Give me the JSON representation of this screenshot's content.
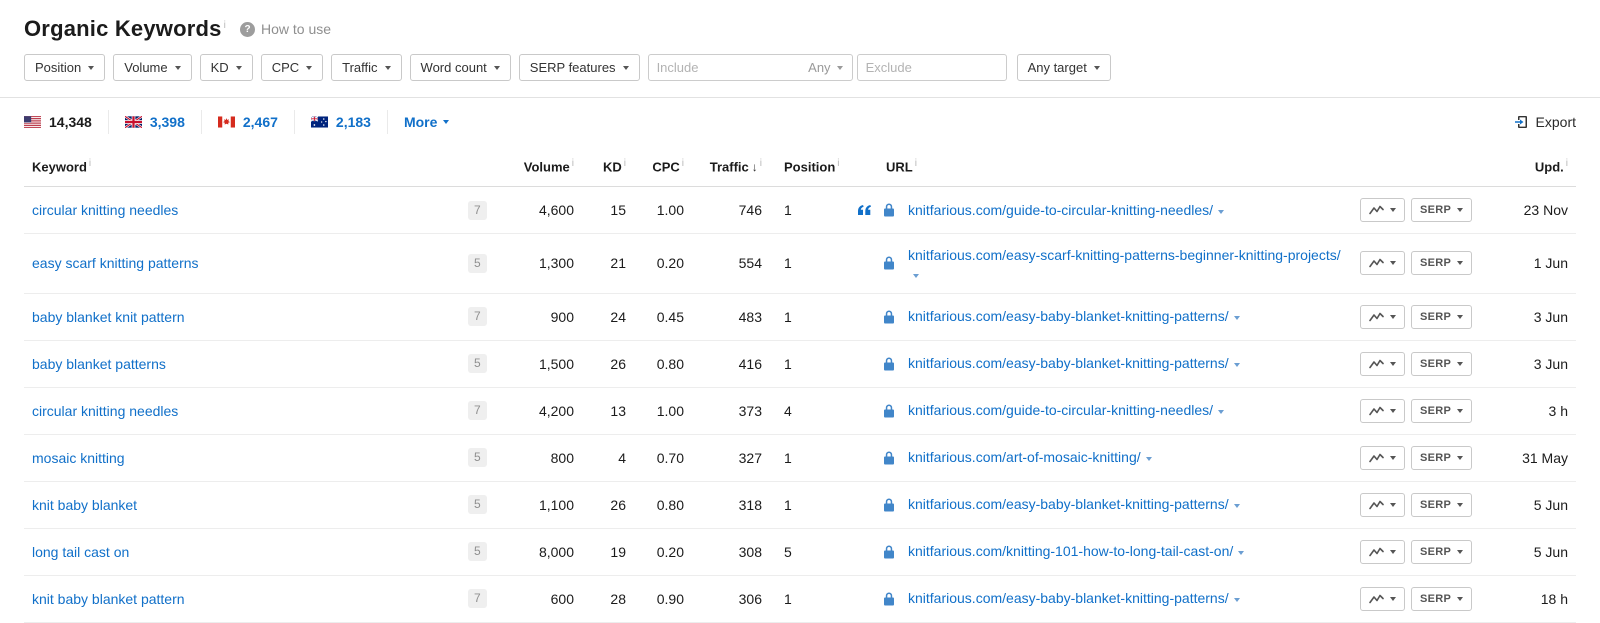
{
  "colors": {
    "link": "#1170c9",
    "text": "#1b1b1b",
    "muted": "#8f8f8f",
    "border": "#c9c9c9",
    "lock": "#4186c9"
  },
  "misc": {
    "info_mark": "i"
  },
  "header": {
    "title": "Organic Keywords",
    "help_mark": "?",
    "how_to_use": "How to use"
  },
  "filters": {
    "dropdowns": [
      "Position",
      "Volume",
      "KD",
      "CPC",
      "Traffic",
      "Word count",
      "SERP features"
    ],
    "include": {
      "placeholder": "Include",
      "mode": "Any"
    },
    "exclude": {
      "placeholder": "Exclude"
    },
    "target_label": "Any target"
  },
  "tabs": {
    "items": [
      {
        "country": "United States",
        "count": "14,348",
        "active": true
      },
      {
        "country": "United Kingdom",
        "count": "3,398",
        "active": false
      },
      {
        "country": "Canada",
        "count": "2,467",
        "active": false
      },
      {
        "country": "Australia",
        "count": "2,183",
        "active": false
      }
    ],
    "more_label": "More",
    "export_label": "Export"
  },
  "table": {
    "headers": {
      "keyword": "Keyword",
      "volume": "Volume",
      "kd": "KD",
      "cpc": "CPC",
      "traffic": "Traffic",
      "position": "Position",
      "url": "URL",
      "upd": "Upd."
    },
    "sort_indicator": "↓",
    "serp_button_label": "SERP",
    "rows": [
      {
        "keyword": "circular knitting needles",
        "badge": "7",
        "volume": "4,600",
        "kd": "15",
        "cpc": "1.00",
        "traffic": "746",
        "position": "1",
        "quote": true,
        "url": "knitfarious.com/guide-to-circular-knitting-needles/",
        "upd": "23 Nov"
      },
      {
        "keyword": "easy scarf knitting patterns",
        "badge": "5",
        "volume": "1,300",
        "kd": "21",
        "cpc": "0.20",
        "traffic": "554",
        "position": "1",
        "quote": false,
        "url": "knitfarious.com/easy-scarf-knitting-patterns-beginner-knitting-projects/",
        "upd": "1 Jun"
      },
      {
        "keyword": "baby blanket knit pattern",
        "badge": "7",
        "volume": "900",
        "kd": "24",
        "cpc": "0.45",
        "traffic": "483",
        "position": "1",
        "quote": false,
        "url": "knitfarious.com/easy-baby-blanket-knitting-patterns/",
        "upd": "3 Jun"
      },
      {
        "keyword": "baby blanket patterns",
        "badge": "5",
        "volume": "1,500",
        "kd": "26",
        "cpc": "0.80",
        "traffic": "416",
        "position": "1",
        "quote": false,
        "url": "knitfarious.com/easy-baby-blanket-knitting-patterns/",
        "upd": "3 Jun"
      },
      {
        "keyword": "circular knitting needles",
        "badge": "7",
        "volume": "4,200",
        "kd": "13",
        "cpc": "1.00",
        "traffic": "373",
        "position": "4",
        "quote": false,
        "url": "knitfarious.com/guide-to-circular-knitting-needles/",
        "upd": "3 h"
      },
      {
        "keyword": "mosaic knitting",
        "badge": "5",
        "volume": "800",
        "kd": "4",
        "cpc": "0.70",
        "traffic": "327",
        "position": "1",
        "quote": false,
        "url": "knitfarious.com/art-of-mosaic-knitting/",
        "upd": "31 May"
      },
      {
        "keyword": "knit baby blanket",
        "badge": "5",
        "volume": "1,100",
        "kd": "26",
        "cpc": "0.80",
        "traffic": "318",
        "position": "1",
        "quote": false,
        "url": "knitfarious.com/easy-baby-blanket-knitting-patterns/",
        "upd": "5 Jun"
      },
      {
        "keyword": "long tail cast on",
        "badge": "5",
        "volume": "8,000",
        "kd": "19",
        "cpc": "0.20",
        "traffic": "308",
        "position": "5",
        "quote": false,
        "url": "knitfarious.com/knitting-101-how-to-long-tail-cast-on/",
        "upd": "5 Jun"
      },
      {
        "keyword": "knit baby blanket pattern",
        "badge": "7",
        "volume": "600",
        "kd": "28",
        "cpc": "0.90",
        "traffic": "306",
        "position": "1",
        "quote": false,
        "url": "knitfarious.com/easy-baby-blanket-knitting-patterns/",
        "upd": "18 h"
      }
    ]
  }
}
